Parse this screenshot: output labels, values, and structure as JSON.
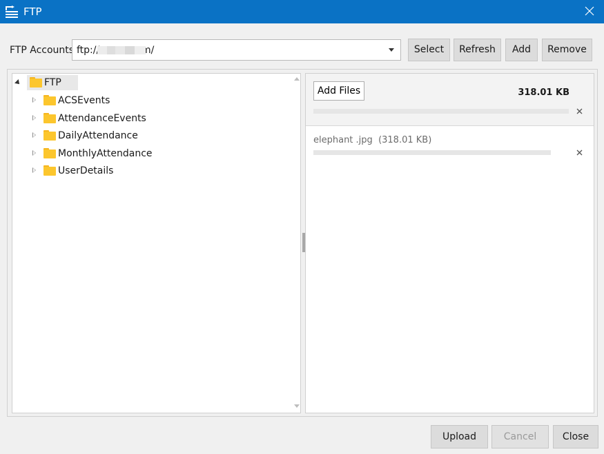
{
  "window": {
    "title": "FTP",
    "icon": "ftp-transfer-icon",
    "close_icon": "close-icon"
  },
  "accounts": {
    "label": "FTP Accounts",
    "selected_value": "ftp://          com/",
    "buttons": {
      "select": "Select",
      "refresh": "Refresh",
      "add": "Add",
      "remove": "Remove"
    }
  },
  "tree": {
    "root": {
      "label": "FTP",
      "expanded": true
    },
    "children": [
      {
        "label": "ACSEvents"
      },
      {
        "label": "AttendanceEvents"
      },
      {
        "label": "DailyAttendance"
      },
      {
        "label": "MonthlyAttendance"
      },
      {
        "label": "UserDetails"
      }
    ]
  },
  "upload": {
    "add_files_label": "Add Files",
    "total_size": "318.01 KB",
    "total_progress": 0,
    "files": [
      {
        "name": "elephant .jpg",
        "size": "(318.01 KB)",
        "progress": 0
      }
    ]
  },
  "footer": {
    "upload": "Upload",
    "cancel": "Cancel",
    "close": "Close"
  },
  "colors": {
    "titlebar": "#0a72c5",
    "folder": "#fcc62d",
    "button": "#dcdcdc"
  }
}
